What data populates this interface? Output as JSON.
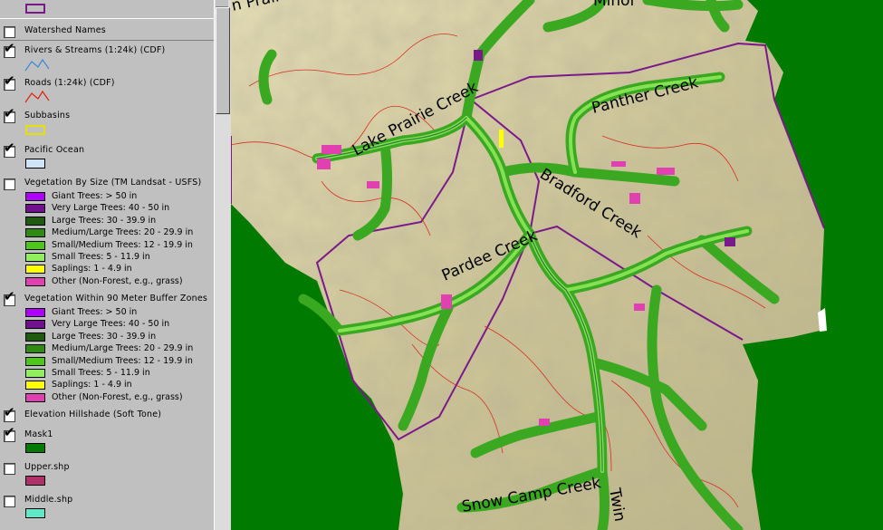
{
  "toc": {
    "layers": [
      {
        "id": "watershed-names",
        "label": "Watershed Names",
        "checked": false
      },
      {
        "id": "rivers",
        "label": "Rivers & Streams (1:24k) (CDF)",
        "checked": true
      },
      {
        "id": "roads",
        "label": "Roads (1:24k) (CDF)",
        "checked": true
      },
      {
        "id": "subbasins",
        "label": "Subbasins",
        "checked": true
      },
      {
        "id": "pacific",
        "label": "Pacific Ocean",
        "checked": true
      },
      {
        "id": "veg-size",
        "label": "Vegetation By Size (TM Landsat - USFS)",
        "checked": false
      },
      {
        "id": "veg-buffer",
        "label": "Vegetation Within 90 Meter Buffer Zones",
        "checked": true
      },
      {
        "id": "hillshade",
        "label": "Elevation Hillshade (Soft Tone)",
        "checked": true
      },
      {
        "id": "mask1",
        "label": "Mask1",
        "checked": true
      },
      {
        "id": "upper",
        "label": "Upper.shp",
        "checked": false
      },
      {
        "id": "middle",
        "label": "Middle.shp",
        "checked": false
      }
    ],
    "veg_classes_size": [
      {
        "label": "Giant Trees: > 50 in",
        "color": "#b000ff"
      },
      {
        "label": "Very Large Trees: 40 - 50 in",
        "color": "#70108a"
      },
      {
        "label": "Large Trees: 30 - 39.9 in",
        "color": "#1f5a10"
      },
      {
        "label": "Medium/Large Trees: 20 - 29.9 in",
        "color": "#2f8a10"
      },
      {
        "label": "Small/Medium Trees: 12 - 19.9 in",
        "color": "#4cc818"
      },
      {
        "label": "Small Trees: 5 - 11.9 in",
        "color": "#90ee60"
      },
      {
        "label": "Saplings: 1 - 4.9 in",
        "color": "#ffff00"
      },
      {
        "label": "Other (Non-Forest, e.g., grass)",
        "color": "#e040b0"
      }
    ],
    "veg_classes_buffer": [
      {
        "label": "Giant Trees: > 50 in",
        "color": "#b000ff"
      },
      {
        "label": "Very Large Trees: 40 - 50 in",
        "color": "#70108a"
      },
      {
        "label": "Large Trees: 30 - 39.9 in",
        "color": "#1f5a10"
      },
      {
        "label": "Medium/Large Trees: 20 - 29.9 in",
        "color": "#2f8a10"
      },
      {
        "label": "Small/Medium Trees: 12 - 19.9 in",
        "color": "#4cc818"
      },
      {
        "label": "Small Trees: 5 - 11.9 in",
        "color": "#90ee60"
      },
      {
        "label": "Saplings: 1 - 4.9 in",
        "color": "#ffff00"
      },
      {
        "label": "Other (Non-Forest, e.g., grass)",
        "color": "#e040b0"
      }
    ],
    "symbols": {
      "top_swatch_color": "#7a1a8a",
      "rivers_color": "#3a8ad8",
      "roads_color": "#e02010",
      "subbasins_color": "#e8e000",
      "pacific_color": "#d0e4f8",
      "mask1_color": "#007a00",
      "upper_color": "#b0306a",
      "middle_color": "#60e8c8"
    }
  },
  "map": {
    "labels": {
      "lake_prairie_top": "n Prairie Cre",
      "minor": "Minor",
      "lake_prairie": "Lake Prairie Creek",
      "panther": "Panther Creek",
      "bradford": "Bradford Creek",
      "pardee": "Pardee Creek",
      "snow_camp": "Snow Camp Creek",
      "twin": "Twin"
    },
    "colors": {
      "mask": "#007a00",
      "terrain": "#d6cfa2",
      "boundary": "#7a1a8a",
      "stream": "#3a9c2a"
    }
  }
}
